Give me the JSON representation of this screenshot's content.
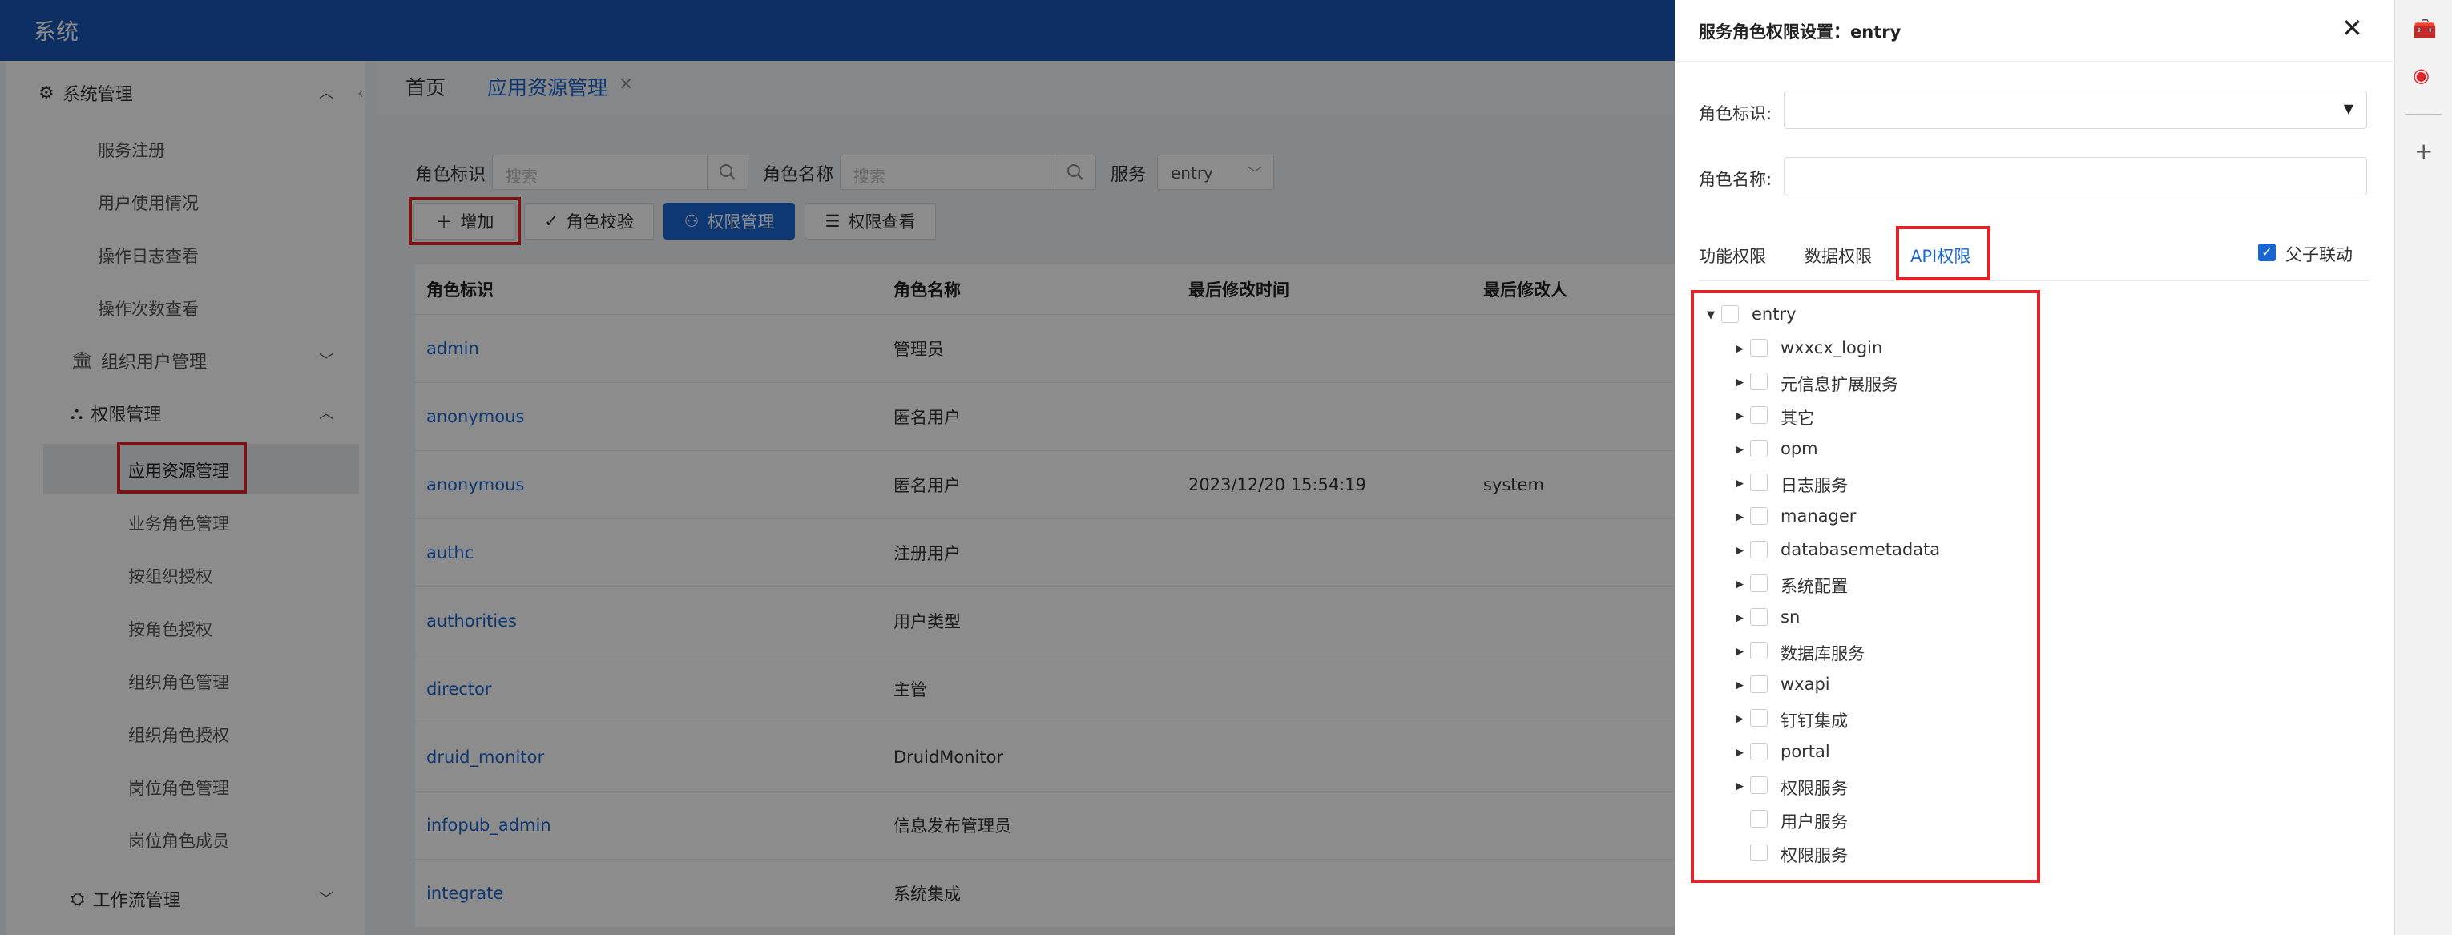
{
  "app": {
    "title": "系统"
  },
  "sidebar": {
    "groups": [
      {
        "label": "系统管理",
        "chevron": "up"
      },
      {
        "label": "组织用户管理",
        "chevron": "down"
      },
      {
        "label": "权限管理",
        "chevron": "up"
      },
      {
        "label": "工作流管理",
        "chevron": "down"
      }
    ],
    "sys_items": [
      "服务注册",
      "用户使用情况",
      "操作日志查看",
      "操作次数查看"
    ],
    "perm_items": [
      "应用资源管理",
      "业务角色管理",
      "按组织授权",
      "按角色授权",
      "组织角色管理",
      "组织角色授权",
      "岗位角色管理",
      "岗位角色成员"
    ]
  },
  "tabs": [
    {
      "label": "首页"
    },
    {
      "label": "应用资源管理",
      "active": true
    }
  ],
  "filters": {
    "role_id_label": "角色标识",
    "role_id_placeholder": "搜索",
    "role_name_label": "角色名称",
    "role_name_placeholder": "搜索",
    "service_label": "服务",
    "service_value": "entry"
  },
  "toolbar": {
    "add": "增加",
    "validate": "角色校验",
    "perm_manage": "权限管理",
    "perm_view": "权限查看"
  },
  "table": {
    "columns": [
      "角色标识",
      "角色名称",
      "最后修改时间",
      "最后修改人"
    ],
    "rows": [
      [
        "admin",
        "管理员",
        "",
        ""
      ],
      [
        "anonymous",
        "匿名用户",
        "",
        ""
      ],
      [
        "anonymous",
        "匿名用户",
        "2023/12/20 15:54:19",
        "system"
      ],
      [
        "authc",
        "注册用户",
        "",
        ""
      ],
      [
        "authorities",
        "用户类型",
        "",
        ""
      ],
      [
        "director",
        "主管",
        "",
        ""
      ],
      [
        "druid_monitor",
        "DruidMonitor",
        "",
        ""
      ],
      [
        "infopub_admin",
        "信息发布管理员",
        "",
        ""
      ],
      [
        "integrate",
        "系统集成",
        "",
        ""
      ]
    ]
  },
  "drawer": {
    "title": "服务角色权限设置：entry",
    "role_id_label": "角色标识:",
    "role_name_label": "角色名称:",
    "tabs": [
      "功能权限",
      "数据权限",
      "API权限"
    ],
    "active_tab": "API权限",
    "linkage_label": "父子联动",
    "linkage_checked": true,
    "tree": {
      "root": "entry",
      "children": [
        {
          "label": "wxxcx_login",
          "expandable": true
        },
        {
          "label": "元信息扩展服务",
          "expandable": true
        },
        {
          "label": "其它",
          "expandable": true
        },
        {
          "label": "opm",
          "expandable": true
        },
        {
          "label": "日志服务",
          "expandable": true
        },
        {
          "label": "manager",
          "expandable": true
        },
        {
          "label": "databasemetadata",
          "expandable": true
        },
        {
          "label": "系统配置",
          "expandable": true
        },
        {
          "label": "sn",
          "expandable": true
        },
        {
          "label": "数据库服务",
          "expandable": true
        },
        {
          "label": "wxapi",
          "expandable": true
        },
        {
          "label": "钉钉集成",
          "expandable": true
        },
        {
          "label": "portal",
          "expandable": true
        },
        {
          "label": "权限服务",
          "expandable": true
        },
        {
          "label": "用户服务",
          "expandable": false
        },
        {
          "label": "权限服务",
          "expandable": false
        }
      ]
    }
  },
  "colors": {
    "primary": "#1a66d1",
    "header": "#1a56b4",
    "highlight": "#e0232b"
  }
}
